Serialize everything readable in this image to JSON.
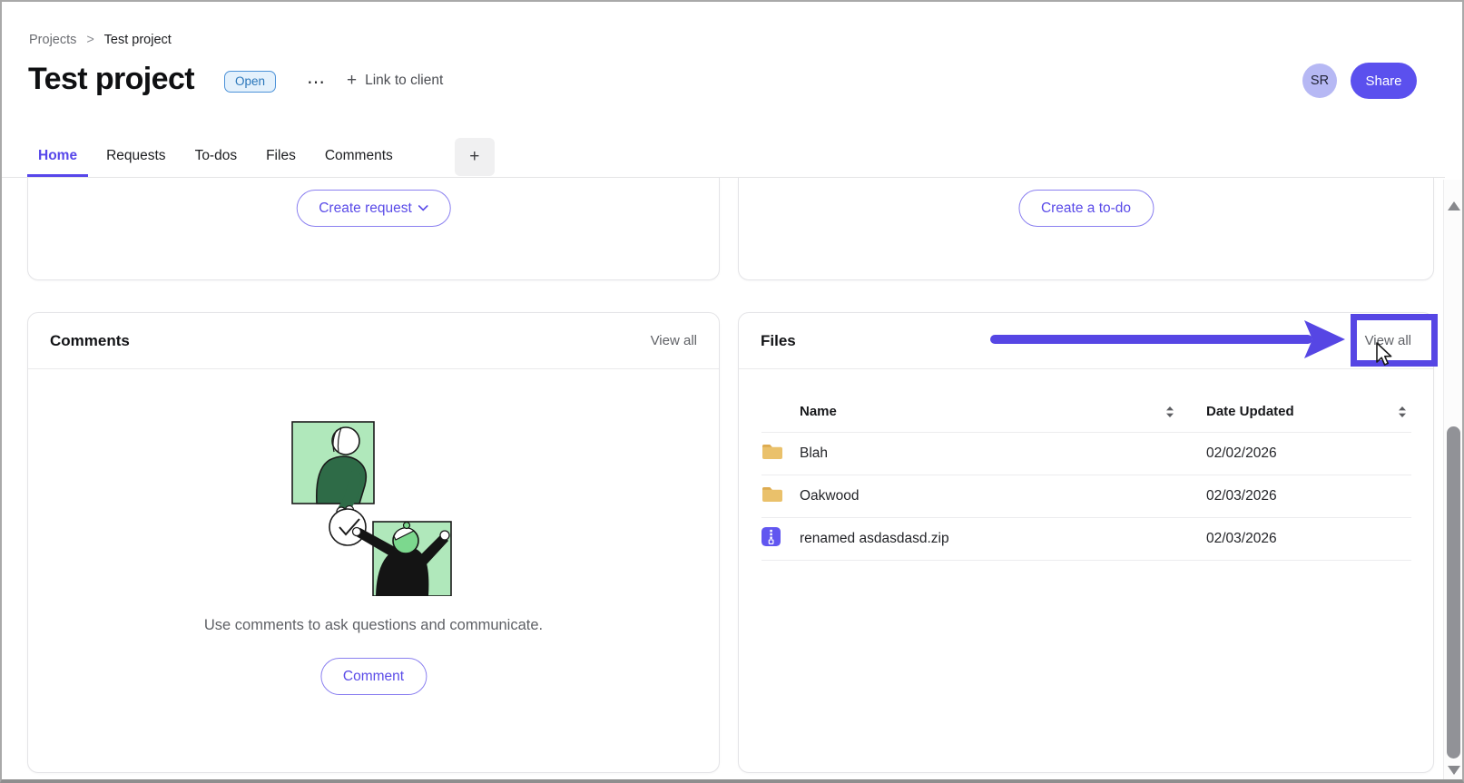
{
  "breadcrumb": {
    "items": [
      "Projects",
      "Test project"
    ],
    "separator": ">"
  },
  "header": {
    "title": "Test project",
    "status": "Open",
    "more": "⋯",
    "plus": "+",
    "link_to_client": "Link to client",
    "avatar": "SR",
    "share": "Share"
  },
  "tabs": {
    "items": [
      {
        "label": "Home",
        "active": true
      },
      {
        "label": "Requests",
        "active": false
      },
      {
        "label": "To-dos",
        "active": false
      },
      {
        "label": "Files",
        "active": false
      },
      {
        "label": "Comments",
        "active": false
      }
    ],
    "add": "+"
  },
  "cards": {
    "requests": {
      "button": "Create request"
    },
    "todos": {
      "button": "Create a to-do"
    },
    "comments": {
      "title": "Comments",
      "view_all": "View all",
      "empty_message": "Use comments to ask questions and communicate.",
      "button": "Comment"
    },
    "files": {
      "title": "Files",
      "view_all": "View all",
      "table": {
        "columns": [
          "Name",
          "Date Updated"
        ],
        "rows": [
          {
            "icon": "folder-icon",
            "name": "Blah",
            "date": "02/02/2026"
          },
          {
            "icon": "folder-icon",
            "name": "Oakwood",
            "date": "02/03/2026"
          },
          {
            "icon": "zip-file-icon",
            "name": "renamed asdasdasd.zip",
            "date": "02/03/2026"
          }
        ]
      }
    }
  },
  "colors": {
    "accent_purple": "#5747ea",
    "annotation_purple": "#5646e4",
    "share_button_bg": "#5b50ee",
    "avatar_bg": "#b6b8f4",
    "open_badge_bg": "#e4f1fc",
    "open_badge_border": "#4c92d8",
    "open_badge_text": "#2a76ba",
    "folder_icon": "#eac16b",
    "zip_icon": "#6156f0",
    "illustration_green": "#b0e8bb",
    "illustration_dark_green": "#2e6b47"
  }
}
